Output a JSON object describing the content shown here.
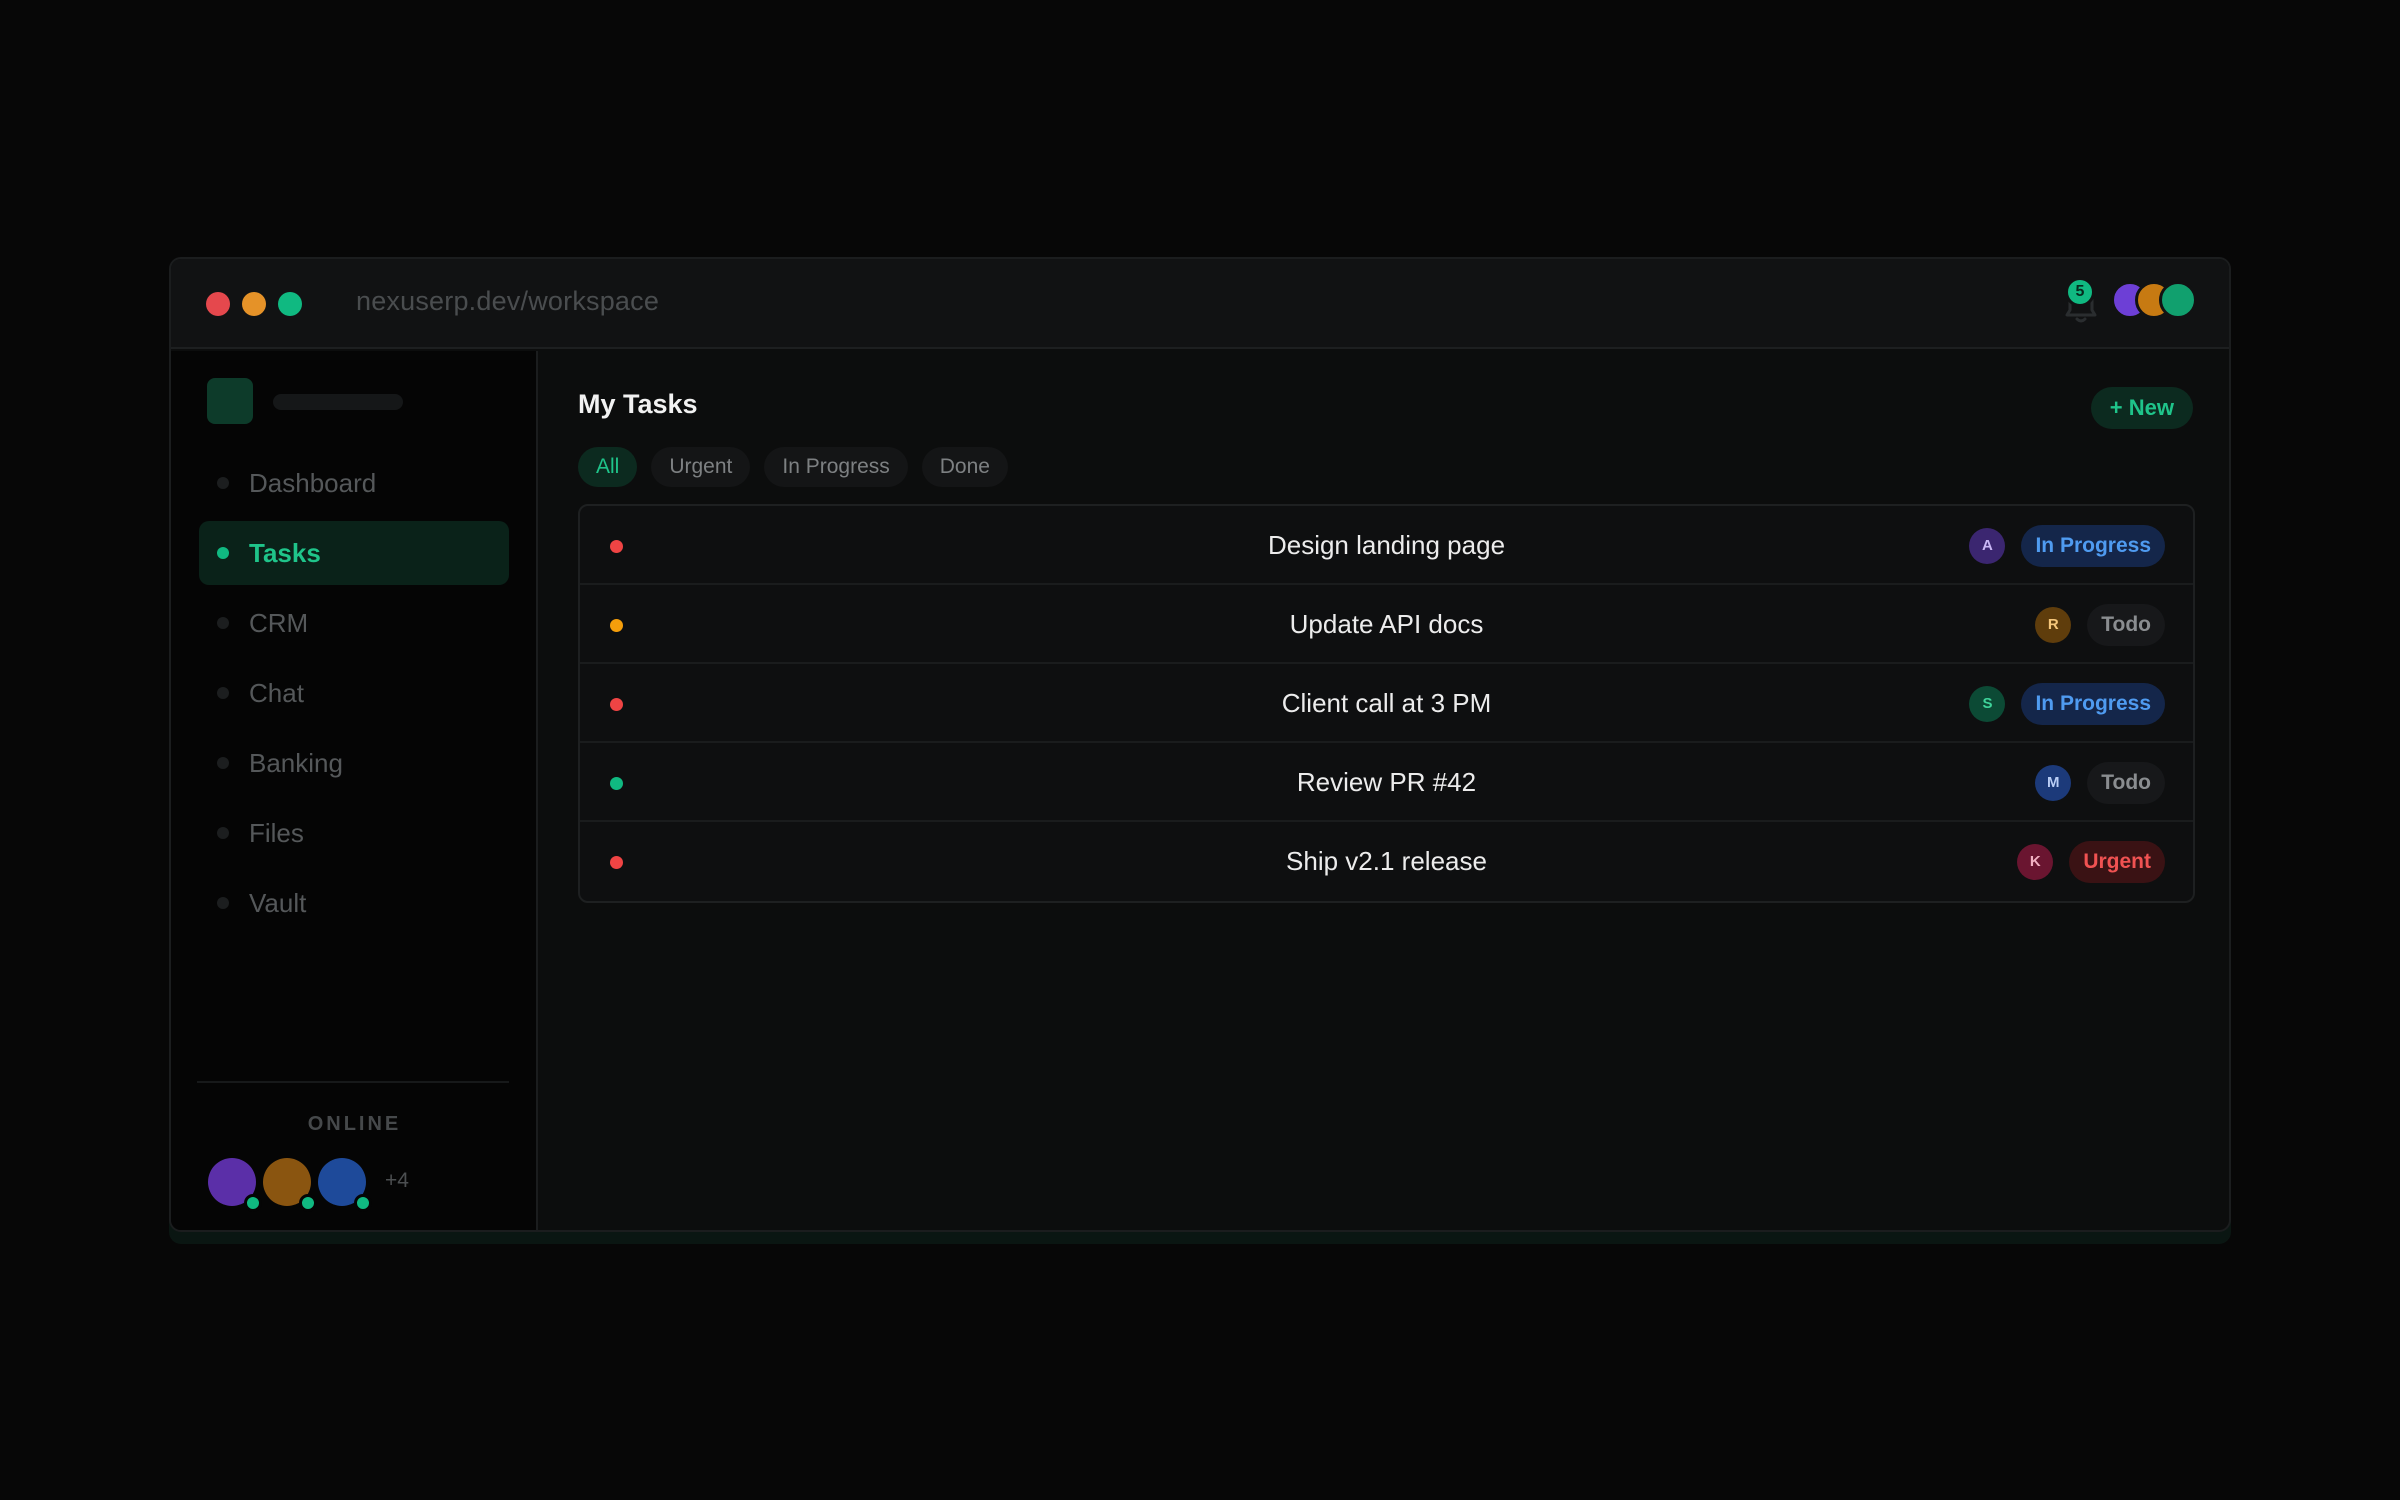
{
  "browser": {
    "url": "nexuserp.dev/workspace",
    "traffic_lights": [
      "#e5484d",
      "#e59228",
      "#10b981"
    ],
    "notifications_count": "5",
    "top_avatar_colors": [
      "#6d3fd6",
      "#c77a12",
      "#11a06e"
    ]
  },
  "sidebar": {
    "items": [
      {
        "label": "Dashboard",
        "active": false
      },
      {
        "label": "Tasks",
        "active": true
      },
      {
        "label": "CRM",
        "active": false
      },
      {
        "label": "Chat",
        "active": false
      },
      {
        "label": "Banking",
        "active": false
      },
      {
        "label": "Files",
        "active": false
      },
      {
        "label": "Vault",
        "active": false
      }
    ],
    "online_label": "ONLINE",
    "online_avatar_colors": [
      "#5b2fa8",
      "#8a5510",
      "#1e4a9a"
    ],
    "online_more": "+4"
  },
  "main": {
    "title": "My Tasks",
    "new_button": "+ New",
    "filters": [
      {
        "label": "All",
        "active": true
      },
      {
        "label": "Urgent",
        "active": false
      },
      {
        "label": "In Progress",
        "active": false
      },
      {
        "label": "Done",
        "active": false
      }
    ],
    "tasks": [
      {
        "title": "Design landing page",
        "priority_color": "#ef4444",
        "assignee": "A",
        "assignee_bg": "#3b2670",
        "assignee_fg": "#c9b7f5",
        "status": "In Progress",
        "status_bg": "#14264a",
        "status_fg": "#4f9bf0"
      },
      {
        "title": "Update API docs",
        "priority_color": "#f59e0b",
        "assignee": "R",
        "assignee_bg": "#5f3d0c",
        "assignee_fg": "#f5c67a",
        "status": "Todo",
        "status_bg": "#17181a",
        "status_fg": "#8a8d90"
      },
      {
        "title": "Client call at 3 PM",
        "priority_color": "#ef4444",
        "assignee": "S",
        "assignee_bg": "#0c4a35",
        "assignee_fg": "#3fd39a",
        "status": "In Progress",
        "status_bg": "#14264a",
        "status_fg": "#4f9bf0"
      },
      {
        "title": "Review PR #42",
        "priority_color": "#10b981",
        "assignee": "M",
        "assignee_bg": "#1c3a7a",
        "assignee_fg": "#b9cdf5",
        "status": "Todo",
        "status_bg": "#17181a",
        "status_fg": "#8a8d90"
      },
      {
        "title": "Ship v2.1 release",
        "priority_color": "#ef4444",
        "assignee": "K",
        "assignee_bg": "#6a1530",
        "assignee_fg": "#f2b1c2",
        "status": "Urgent",
        "status_bg": "#3a1214",
        "status_fg": "#f05252"
      }
    ]
  }
}
